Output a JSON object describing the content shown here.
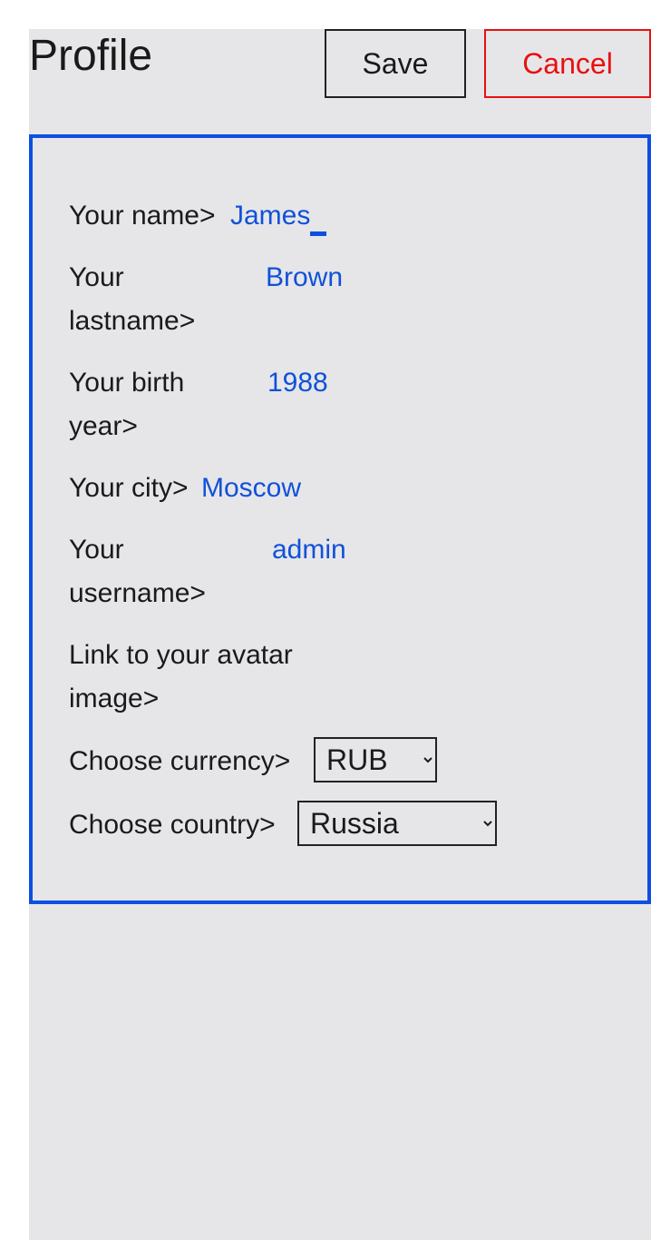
{
  "header": {
    "title": "Profile",
    "save_label": "Save",
    "cancel_label": "Cancel"
  },
  "form": {
    "name": {
      "label": "Your name>",
      "value": "James"
    },
    "lastname": {
      "label_line1": "Your",
      "label_line2": "lastname>",
      "value": "Brown"
    },
    "birth_year": {
      "label_line1": "Your birth",
      "label_line2": "year>",
      "value": "1988"
    },
    "city": {
      "label": "Your city>",
      "value": "Moscow"
    },
    "username": {
      "label_line1": "Your",
      "label_line2": "username>",
      "value": "admin"
    },
    "avatar": {
      "label_line1": "Link to your avatar",
      "label_line2": "image>",
      "value": ""
    },
    "currency": {
      "label": "Choose currency>",
      "selected": "RUB"
    },
    "country": {
      "label": "Choose country>",
      "selected": "Russia"
    }
  },
  "colors": {
    "accent": "#0d4fe0",
    "value_text": "#1051d8",
    "cancel": "#e81010",
    "panel_bg": "#e6e6e9"
  }
}
